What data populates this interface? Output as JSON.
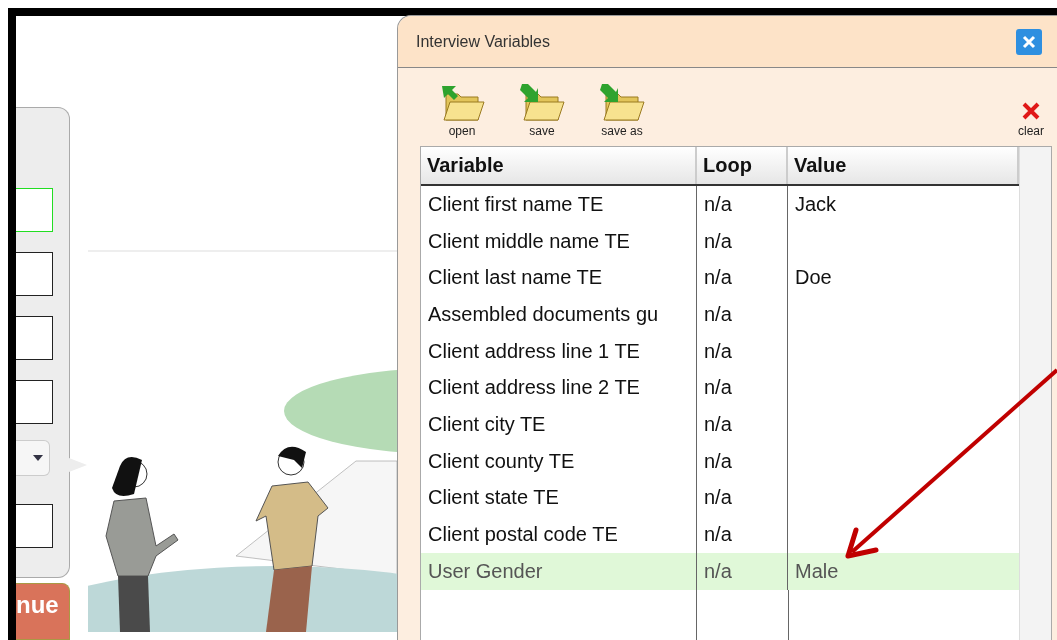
{
  "form_panel": {
    "fields": [
      {
        "kind": "text",
        "focused": true
      },
      {
        "kind": "text",
        "focused": false
      },
      {
        "kind": "text",
        "focused": false
      },
      {
        "kind": "text",
        "focused": false
      },
      {
        "kind": "select",
        "focused": false
      },
      {
        "kind": "text",
        "focused": false
      }
    ],
    "continue_button": "nue"
  },
  "dialog": {
    "title": "Interview Variables",
    "toolbar": [
      {
        "kind": "open",
        "label": "open"
      },
      {
        "kind": "save",
        "label": "save"
      },
      {
        "kind": "save",
        "label": "save as"
      },
      {
        "kind": "clear",
        "label": "clear"
      }
    ],
    "table": {
      "columns": [
        "Variable",
        "Loop",
        "Value"
      ],
      "rows": [
        {
          "variable": "Client first name TE",
          "loop": "n/a",
          "value": "Jack",
          "selected": false
        },
        {
          "variable": "Client middle name TE",
          "loop": "n/a",
          "value": "",
          "selected": false
        },
        {
          "variable": "Client last name TE",
          "loop": "n/a",
          "value": "Doe",
          "selected": false
        },
        {
          "variable": "Assembled documents gu",
          "loop": "n/a",
          "value": "",
          "selected": false
        },
        {
          "variable": "Client address line 1 TE",
          "loop": "n/a",
          "value": "",
          "selected": false
        },
        {
          "variable": "Client address line 2 TE",
          "loop": "n/a",
          "value": "",
          "selected": false
        },
        {
          "variable": "Client city TE",
          "loop": "n/a",
          "value": "",
          "selected": false
        },
        {
          "variable": "Client county TE",
          "loop": "n/a",
          "value": "",
          "selected": false
        },
        {
          "variable": "Client state TE",
          "loop": "n/a",
          "value": "",
          "selected": false
        },
        {
          "variable": "Client postal code TE",
          "loop": "n/a",
          "value": "",
          "selected": false
        },
        {
          "variable": "User Gender",
          "loop": "n/a",
          "value": "Male",
          "selected": true
        }
      ]
    }
  }
}
